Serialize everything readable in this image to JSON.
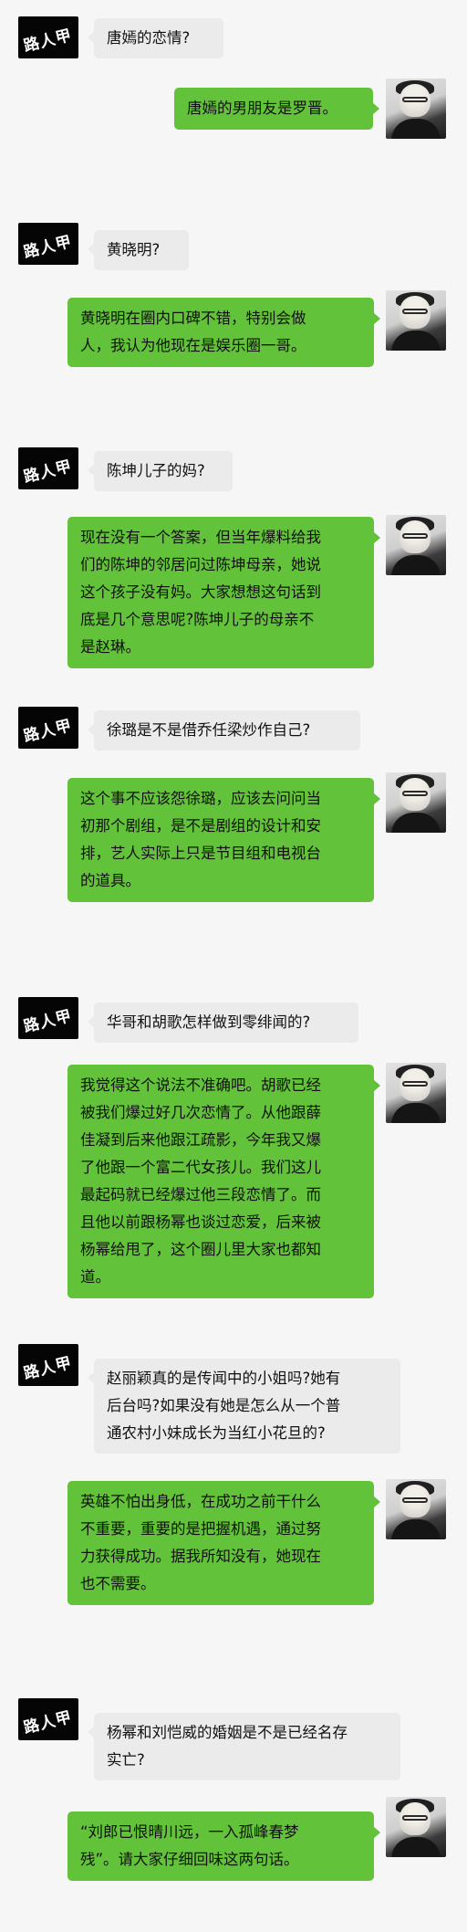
{
  "app": {
    "avatar_left_text": "路人甲",
    "colors": {
      "question_bubble": "#ebebeb",
      "answer_bubble": "#62c239",
      "background": "#f6f6f6"
    }
  },
  "chat": {
    "messages": [
      {
        "side": "left",
        "avatar": "路人甲",
        "text": "唐嫣的恋情?"
      },
      {
        "side": "right",
        "text": "唐嫣的男朋友是罗晋。"
      },
      {
        "side": "left",
        "avatar": "路人甲",
        "text": "黄晓明?"
      },
      {
        "side": "right",
        "text": "黄晓明在圈内口碑不错，特别会做\n人，我认为他现在是娱乐圈一哥。"
      },
      {
        "side": "left",
        "avatar": "路人甲",
        "text": "陈坤儿子的妈?"
      },
      {
        "side": "right",
        "text": "现在没有一个答案，但当年爆料给我\n们的陈坤的邻居问过陈坤母亲，她说\n这个孩子没有妈。大家想想这句话到\n底是几个意思呢?陈坤儿子的母亲不\n是赵琳。"
      },
      {
        "side": "left",
        "avatar": "路人甲",
        "text": "徐璐是不是借乔任梁炒作自己?"
      },
      {
        "side": "right",
        "text": "这个事不应该怨徐璐，应该去问问当\n初那个剧组，是不是剧组的设计和安\n排，艺人实际上只是节目组和电视台\n的道具。"
      },
      {
        "side": "left",
        "avatar": "路人甲",
        "text": "华哥和胡歌怎样做到零绯闻的?"
      },
      {
        "side": "right",
        "text": "我觉得这个说法不准确吧。胡歌已经\n被我们爆过好几次恋情了。从他跟薛\n佳凝到后来他跟江疏影，今年我又爆\n了他跟一个富二代女孩儿。我们这儿\n最起码就已经爆过他三段恋情了。而\n且他以前跟杨幂也谈过恋爱，后来被\n杨幂给甩了，这个圈儿里大家也都知\n道。"
      },
      {
        "side": "left",
        "avatar": "路人甲",
        "text": "赵丽颖真的是传闻中的小姐吗?她有\n后台吗?如果没有她是怎么从一个普\n通农村小妹成长为当红小花旦的?"
      },
      {
        "side": "right",
        "text": "英雄不怕出身低，在成功之前干什么\n不重要，重要的是把握机遇，通过努\n力获得成功。据我所知没有，她现在\n也不需要。"
      },
      {
        "side": "left",
        "avatar": "路人甲",
        "text": "杨幂和刘恺威的婚姻是不是已经名存\n实亡?"
      },
      {
        "side": "right",
        "text": "“刘郎已恨晴川远，一入孤峰春梦\n残”。请大家仔细回味这两句话。"
      }
    ]
  }
}
